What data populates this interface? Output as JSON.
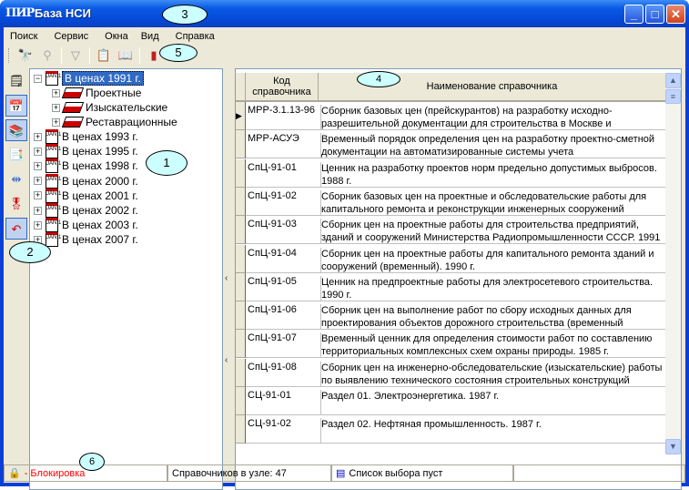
{
  "window": {
    "title": "База НСИ",
    "app_icon": "ПИР"
  },
  "menu": [
    "Поиск",
    "Сервис",
    "Окна",
    "Вид",
    "Справка"
  ],
  "toolbar": [
    "binoculars-icon",
    "find-next-icon",
    "filter-icon",
    "report-icon",
    "book-icon",
    "exit-door-icon"
  ],
  "left_toolbar": [
    "notebook-icon",
    "calendar-icon",
    "books-icon",
    "export-icon",
    "split-icon",
    "award-icon",
    "return-icon"
  ],
  "tree": {
    "root": {
      "label": "В ценах 1991 г.",
      "children": [
        "Проектные",
        "Изыскательские",
        "Реставрационные"
      ]
    },
    "siblings": [
      "В ценах 1993 г.",
      "В ценах 1995 г.",
      "В ценах 1998 г.",
      "В ценах 2000 г.",
      "В ценах 2001 г.",
      "В ценах 2002 г.",
      "В ценах 2003 г.",
      "В ценах 2007 г."
    ]
  },
  "grid": {
    "columns": [
      "Код справочника",
      "Наименование справочника"
    ],
    "rows": [
      {
        "code": "МРР-3.1.13-96",
        "name": "Сборник базовых цен (прейскурантов) на разработку исходно-разрешительной документации для строительства в Москве и"
      },
      {
        "code": "МРР-АСУЭ",
        "name": "Временный порядок определения цен на разработку проектно-сметной документации на автоматизированные системы учета"
      },
      {
        "code": "СпЦ-91-01",
        "name": "Ценник на разработку проектов норм предельно допустимых выбросов. 1988 г."
      },
      {
        "code": "СпЦ-91-02",
        "name": "Сборник базовых цен на проектные и обследовательские работы для капитального ремонта и реконструкции инженерных сооружений"
      },
      {
        "code": "СпЦ-91-03",
        "name": "Сборник цен на проектные работы для строительства предприятий, зданий и сооружений Министерства Радиопромышленности СССР. 1991"
      },
      {
        "code": "СпЦ-91-04",
        "name": "Сборник цен на проектные работы для капитального ремонта зданий и сооружений (временный). 1990 г."
      },
      {
        "code": "СпЦ-91-05",
        "name": "Ценник на предпроектные работы для электросетевого строительства. 1990 г."
      },
      {
        "code": "СпЦ-91-06",
        "name": "Сборник цен на выполнение работ по сбору исходных данных для проектирования объектов дорожного строительства (временный"
      },
      {
        "code": "СпЦ-91-07",
        "name": "Временный ценник для определения стоимости работ по составлению территориальных комплексных схем охраны природы. 1985 г."
      },
      {
        "code": "СпЦ-91-08",
        "name": "Сборник цен на инженерно-обследовательские (изыскательские) работы по выявлению технического состояния строительных конструкций"
      },
      {
        "code": "СЦ-91-01",
        "name": "Раздел 01. Электроэнергетика. 1987 г."
      },
      {
        "code": "СЦ-91-02",
        "name": "Раздел 02. Нефтяная промышленность. 1987 г."
      }
    ]
  },
  "status": {
    "lock": "- Блокировка",
    "count": "Справочников в узле: 47",
    "selection": "Список выбора пуст"
  },
  "callouts": [
    "1",
    "2",
    "3",
    "4",
    "5",
    "6"
  ],
  "colors": {
    "lock_text": "#ff0000",
    "callout_fill": "#ccffff",
    "selection": "#316ac5"
  }
}
